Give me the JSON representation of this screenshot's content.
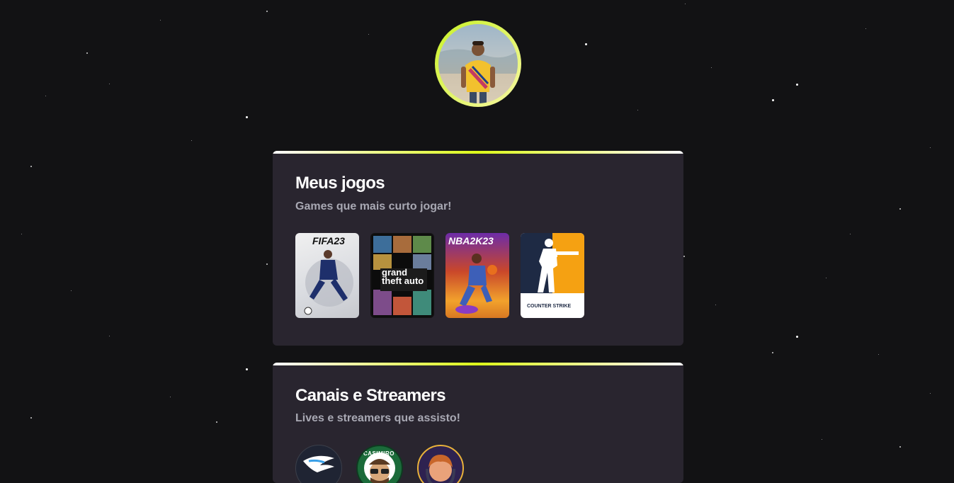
{
  "profile": {
    "avatar_icon": "profile-photo"
  },
  "games_section": {
    "title": "Meus jogos",
    "subtitle": "Games que mais curto jogar!",
    "games": [
      {
        "label": "FIFA23",
        "icon": "fifa23-cover"
      },
      {
        "label": "grand theft auto",
        "icon": "gta5-cover"
      },
      {
        "label": "NBA2K23",
        "icon": "nba2k23-cover"
      },
      {
        "label": "COUNTER STRIKE",
        "icon": "counter-strike-logo"
      }
    ]
  },
  "streams_section": {
    "title": "Canais e Streamers",
    "subtitle": "Lives e streamers que assisto!",
    "channels": [
      {
        "icon": "wings-channel-logo"
      },
      {
        "label": "CASIMIRO",
        "icon": "casimiro-channel-logo"
      },
      {
        "icon": "streamer-avatar"
      }
    ]
  },
  "colors": {
    "background": "#121214",
    "card": "#29252f",
    "accent": "#ddff1a",
    "subtitle": "#a8a8b3"
  }
}
